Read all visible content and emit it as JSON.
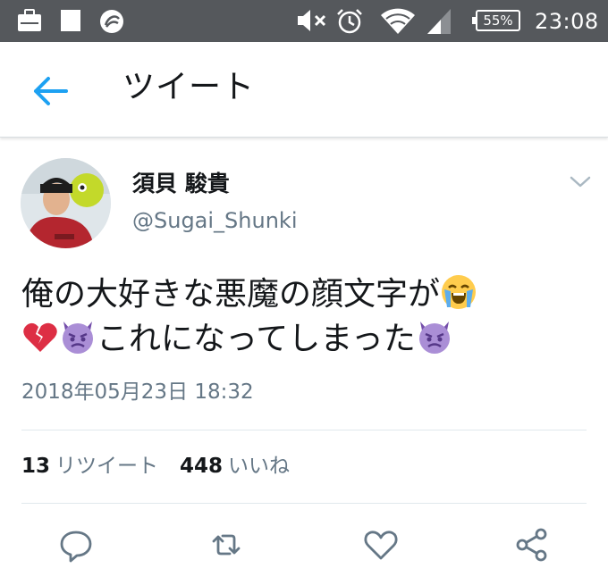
{
  "statusbar": {
    "battery": "55%",
    "time": "23:08",
    "icons": [
      "work-icon",
      "square-icon",
      "app-icon",
      "mute-icon",
      "alarm-icon",
      "wifi-icon",
      "signal-icon",
      "battery-icon"
    ]
  },
  "appbar": {
    "title": "ツイート",
    "back_icon": "arrow-left-icon"
  },
  "tweet": {
    "display_name": "須貝 駿貴",
    "handle": "@Sugai_Shunki",
    "text_line1": "俺の大好きな悪魔の顔文字が",
    "text_line2": "これになってしまった",
    "emojis": [
      "loudly-crying-face",
      "broken-heart",
      "angry-devil",
      "angry-devil"
    ],
    "timestamp": "2018年05月23日 18:32",
    "retweets_count": "13",
    "retweets_label": "リツイート",
    "likes_count": "448",
    "likes_label": "いいね"
  },
  "actions": [
    "reply-icon",
    "retweet-icon",
    "like-icon",
    "share-icon"
  ],
  "colors": {
    "statusbar": "#55585c",
    "accent": "#1da1f2",
    "text": "#14171a",
    "muted": "#657786",
    "action_icon": "#657786"
  }
}
